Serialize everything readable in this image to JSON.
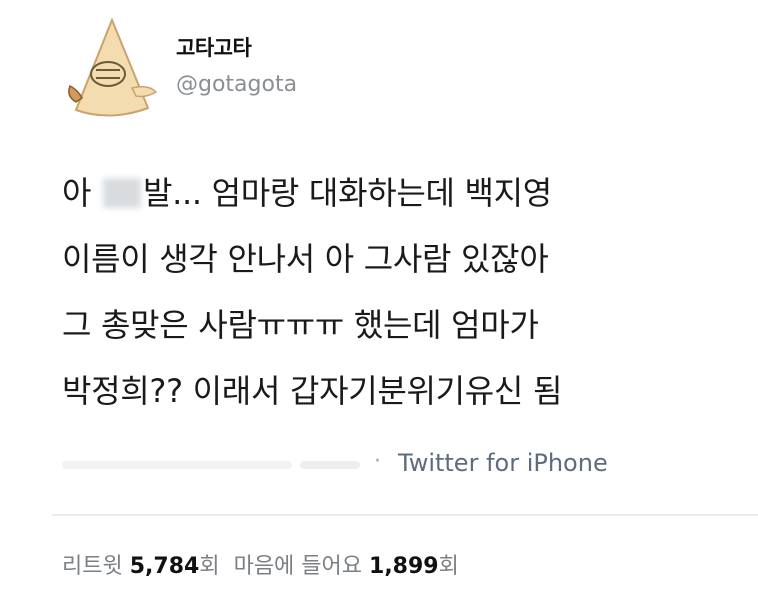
{
  "user": {
    "display_name": "고타고타",
    "handle": "@gotagota",
    "avatar_icon": "cone-character-avatar-icon"
  },
  "tweet": {
    "lines": [
      {
        "before_censor": "아 ",
        "after_censor": "발... 엄마랑 대화하는데 백지영"
      },
      {
        "text": "이름이 생각 안나서 아 그사람 있잖아"
      },
      {
        "text": "그 총맞은 사람ㅠㅠㅠ 했는데 엄마가"
      },
      {
        "text": "박정희?? 이래서 갑자기분위기유신 됨"
      }
    ]
  },
  "meta": {
    "separator": "·",
    "source": "Twitter for iPhone"
  },
  "stats": {
    "retweet_label": "리트윗",
    "retweet_count": "5,784",
    "retweet_unit": "회",
    "like_label": "마음에 들어요",
    "like_count": "1,899",
    "like_unit": "회"
  },
  "colors": {
    "handle": "#8a8f95",
    "source_link": "#5c6d80",
    "divider": "#e9ebed",
    "stat_label": "#7b8086"
  }
}
